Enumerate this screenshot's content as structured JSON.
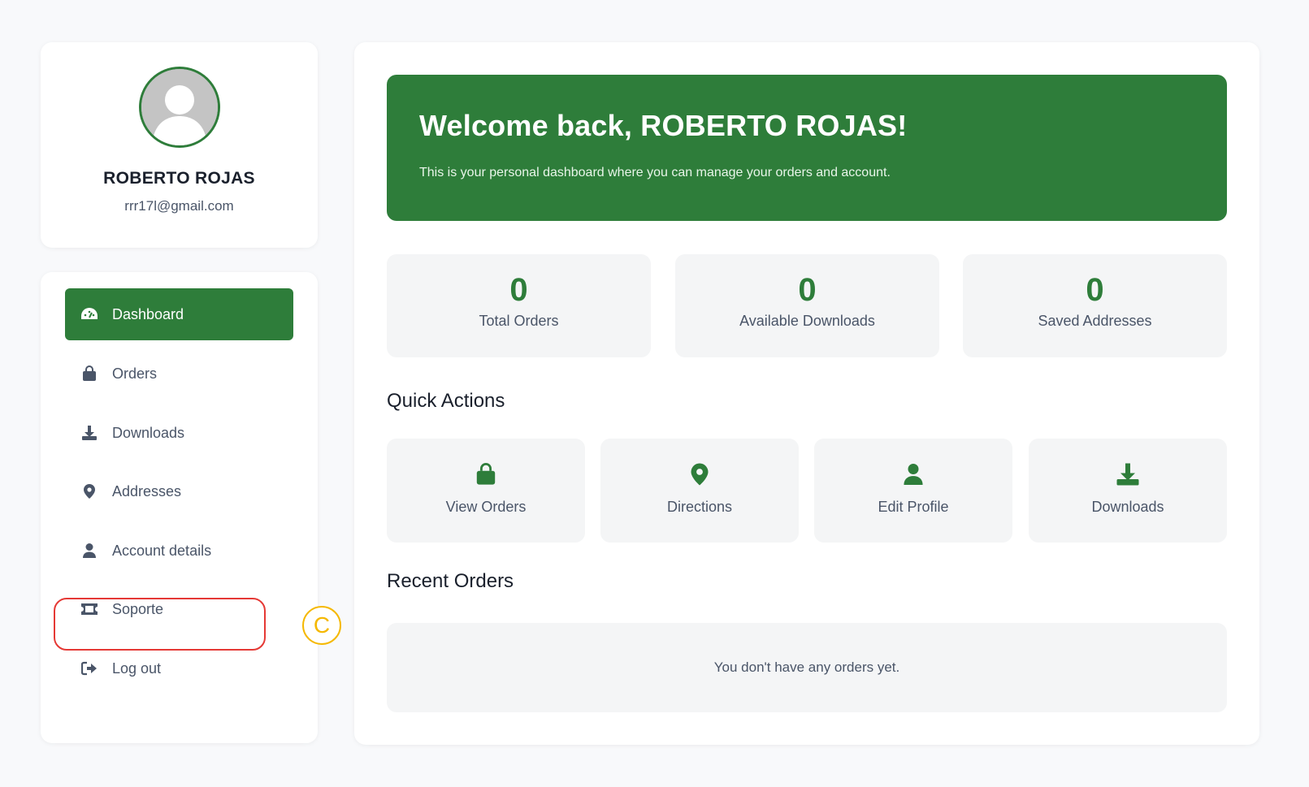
{
  "profile": {
    "name": "ROBERTO ROJAS",
    "email": "rrr17l@gmail.com"
  },
  "nav": {
    "items": [
      {
        "label": "Dashboard",
        "icon": "dashboard-icon"
      },
      {
        "label": "Orders",
        "icon": "shopping-bag-icon"
      },
      {
        "label": "Downloads",
        "icon": "download-icon"
      },
      {
        "label": "Addresses",
        "icon": "map-pin-icon"
      },
      {
        "label": "Account details",
        "icon": "user-icon"
      },
      {
        "label": "Soporte",
        "icon": "ticket-icon"
      },
      {
        "label": "Log out",
        "icon": "logout-icon"
      }
    ],
    "active": "Dashboard"
  },
  "annotation": {
    "marker": "C"
  },
  "welcome": {
    "title": "Welcome back, ROBERTO ROJAS!",
    "subtitle": "This is your personal dashboard where you can manage your orders and account."
  },
  "stats": [
    {
      "value": "0",
      "label": "Total Orders"
    },
    {
      "value": "0",
      "label": "Available Downloads"
    },
    {
      "value": "0",
      "label": "Saved Addresses"
    }
  ],
  "quick_actions": {
    "title": "Quick Actions",
    "items": [
      {
        "label": "View Orders",
        "icon": "shopping-bag-icon"
      },
      {
        "label": "Directions",
        "icon": "map-pin-icon"
      },
      {
        "label": "Edit Profile",
        "icon": "user-icon"
      },
      {
        "label": "Downloads",
        "icon": "download-icon"
      }
    ]
  },
  "recent_orders": {
    "title": "Recent Orders",
    "empty_text": "You don't have any orders yet."
  },
  "colors": {
    "accent": "#2e7d3a",
    "highlight": "#e53935",
    "marker": "#f5b800"
  }
}
